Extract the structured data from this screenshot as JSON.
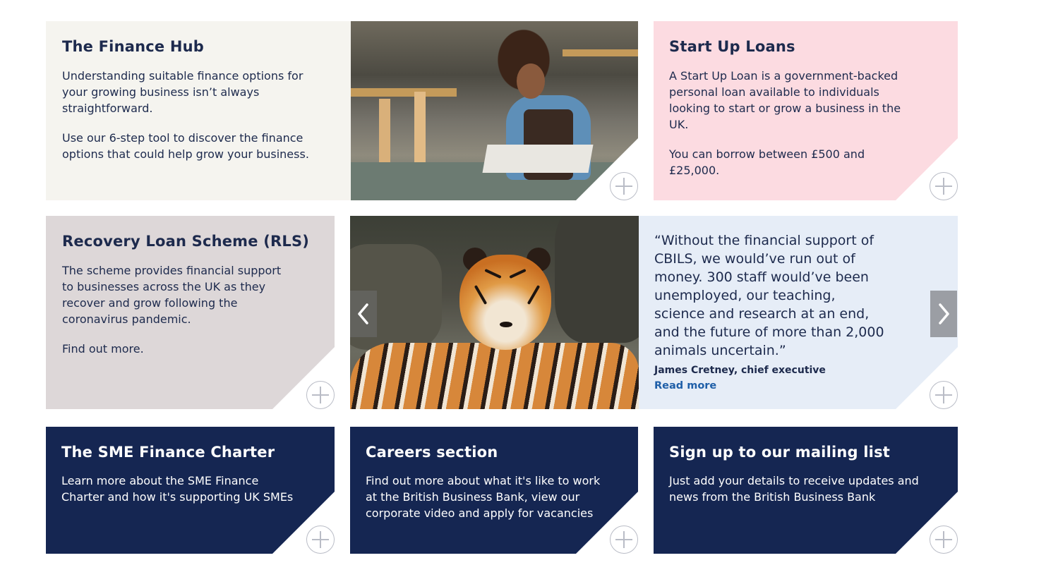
{
  "finance_hub": {
    "title": "The Finance Hub",
    "text1": "Understanding suitable finance options for your growing business isn’t always straightforward.",
    "text2": "Use our 6-step tool to discover the finance options that could help grow your business."
  },
  "start_up_loans": {
    "title": "Start Up Loans",
    "text1": "A Start Up Loan is a government-backed personal loan available to individuals looking to start or grow a business in the UK.",
    "text2": "You can borrow between £500 and £25,000."
  },
  "rls": {
    "title": "Recovery Loan Scheme (RLS)",
    "text1": "The scheme provides financial support to businesses across the UK as they recover and grow following the coronavirus pandemic.",
    "text2": "Find out more."
  },
  "testimonial": {
    "quote": "“Without the financial support of CBILS, we would’ve run out of money. 300 staff would’ve been unemployed, our teaching, science and research at an end, and the future of more than 2,000 animals uncertain.”",
    "author": "James Cretney, chief executive",
    "read_more": "Read more"
  },
  "sme_charter": {
    "title": "The SME Finance Charter",
    "text": "Learn more about the SME Finance Charter and how it's supporting UK SMEs"
  },
  "careers": {
    "title": "Careers section",
    "text": "Find out more about what it's like to work at the British Business Bank, view our corporate video and apply for vacancies"
  },
  "mailing_list": {
    "title": "Sign up to our mailing list",
    "text": "Just add your details to receive updates and news from the British Business Bank"
  },
  "colors": {
    "navy": "#152652",
    "cream": "#f5f4ef",
    "pink": "#fcdbe1",
    "taupe": "#ddd7d8",
    "light_blue": "#e6edf7",
    "link_blue": "#1f5fa8"
  },
  "icons": {
    "expand": "plus-circle-icon",
    "prev": "chevron-left-icon",
    "next": "chevron-right-icon"
  }
}
